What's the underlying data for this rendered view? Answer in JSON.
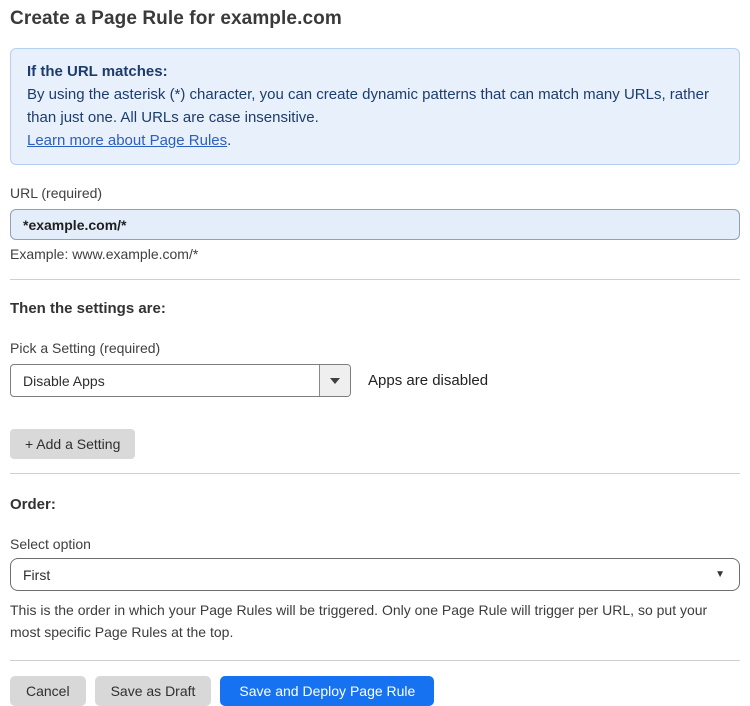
{
  "page": {
    "title": "Create a Page Rule for example.com"
  },
  "info_box": {
    "heading": "If the URL matches:",
    "body": "By using the asterisk (*) character, you can create dynamic patterns that can match many URLs, rather than just one. All URLs are case insensitive.",
    "link_label": "Learn more about Page Rules",
    "link_suffix": "."
  },
  "url_field": {
    "label": "URL (required)",
    "value": "*example.com/*",
    "example": "Example: www.example.com/*"
  },
  "settings_section": {
    "heading": "Then the settings are:",
    "setting_label": "Pick a Setting (required)",
    "setting_value": "Disable Apps",
    "setting_status": "Apps are disabled",
    "add_setting_label": "+ Add a Setting"
  },
  "order_section": {
    "heading": "Order:",
    "select_label": "Select option",
    "select_value": "First",
    "help_text": "This is the order in which your Page Rules will be triggered. Only one Page Rule will trigger per URL, so put your most specific Page Rules at the top."
  },
  "footer": {
    "cancel_label": "Cancel",
    "save_draft_label": "Save as Draft",
    "save_deploy_label": "Save and Deploy Page Rule"
  },
  "colors": {
    "accent_blue": "#1672f0",
    "info_background": "#e8f1fb",
    "info_border": "#b5d0ee",
    "info_text": "#1d3c6e",
    "link_blue": "#2c5fc0",
    "url_input_background": "#e4eefb"
  }
}
